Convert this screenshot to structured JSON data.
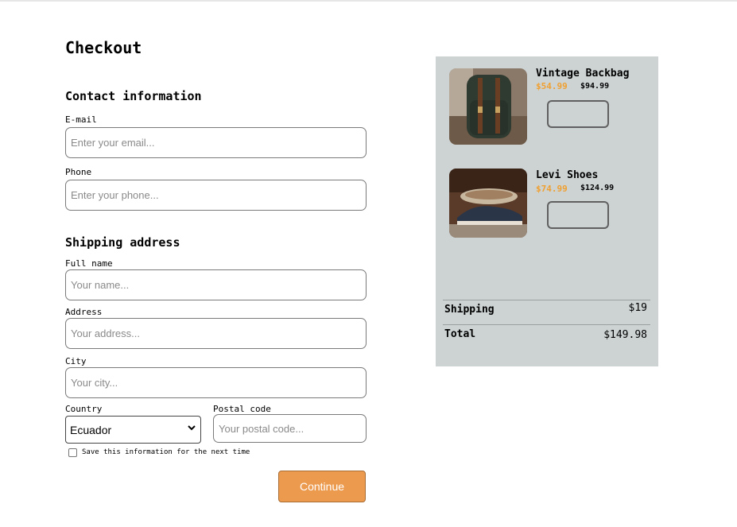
{
  "page": {
    "title": "Checkout"
  },
  "contact": {
    "heading": "Contact information",
    "email_label": "E-mail",
    "email_placeholder": "Enter your email...",
    "phone_label": "Phone",
    "phone_placeholder": "Enter your phone..."
  },
  "shipping": {
    "heading": "Shipping address",
    "name_label": "Full name",
    "name_placeholder": "Your name...",
    "address_label": "Address",
    "address_placeholder": "Your address...",
    "city_label": "City",
    "city_placeholder": "Your city...",
    "country_label": "Country",
    "country_value": "Ecuador",
    "postal_label": "Postal code",
    "postal_placeholder": "Your postal code...",
    "save_label": "Save this information for the next time",
    "continue_label": "Continue"
  },
  "cart": {
    "items": [
      {
        "name": "Vintage Backbag",
        "price": "$54.99",
        "original_price": "$94.99",
        "image": "backpack-photo"
      },
      {
        "name": "Levi Shoes",
        "price": "$74.99",
        "original_price": "$124.99",
        "image": "shoes-photo"
      }
    ],
    "shipping_label": "Shipping",
    "shipping_value": "$19",
    "total_label": "Total",
    "total_value": "$149.98"
  },
  "colors": {
    "accent": "#ec9a4e",
    "sale_price": "#f0a030",
    "summary_bg": "#cdd3d3"
  }
}
